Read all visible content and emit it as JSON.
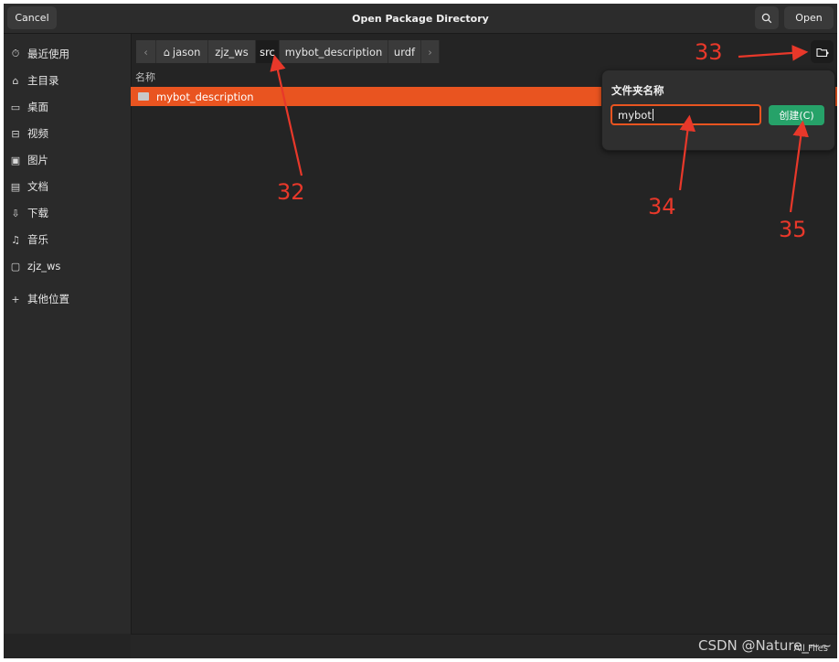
{
  "header": {
    "cancel_label": "Cancel",
    "title": "Open Package Directory",
    "search_icon": "search-icon",
    "open_label": "Open"
  },
  "sidebar": {
    "items": [
      {
        "icon": "⏱",
        "label": "最近使用"
      },
      {
        "icon": "⌂",
        "label": "主目录"
      },
      {
        "icon": "▭",
        "label": "桌面"
      },
      {
        "icon": "⊟",
        "label": "视频"
      },
      {
        "icon": "▣",
        "label": "图片"
      },
      {
        "icon": "▤",
        "label": "文档"
      },
      {
        "icon": "⇩",
        "label": "下载"
      },
      {
        "icon": "♫",
        "label": "音乐"
      },
      {
        "icon": "▢",
        "label": "zjz_ws"
      }
    ],
    "other_locations": {
      "icon": "+",
      "label": "其他位置"
    }
  },
  "pathbar": {
    "back_icon": "‹",
    "forward_icon": "›",
    "home_icon": "⌂",
    "segments": [
      "jason",
      "zjz_ws",
      "src",
      "mybot_description",
      "urdf"
    ]
  },
  "filelist": {
    "column_name": "名称",
    "rows": [
      {
        "name": "mybot_description"
      }
    ]
  },
  "new_folder_popover": {
    "title": "文件夹名称",
    "input_value": "mybot",
    "create_label": "创建(C)"
  },
  "footer": {
    "filter_label": "All Files"
  },
  "annotations": {
    "n32": "32",
    "n33": "33",
    "n34": "34",
    "n35": "35",
    "watermark": "CSDN @Nature_~~"
  },
  "colors": {
    "accent": "#e95420",
    "create_button": "#26a269",
    "annotation": "#e8382a",
    "window_bg": "#242424"
  }
}
